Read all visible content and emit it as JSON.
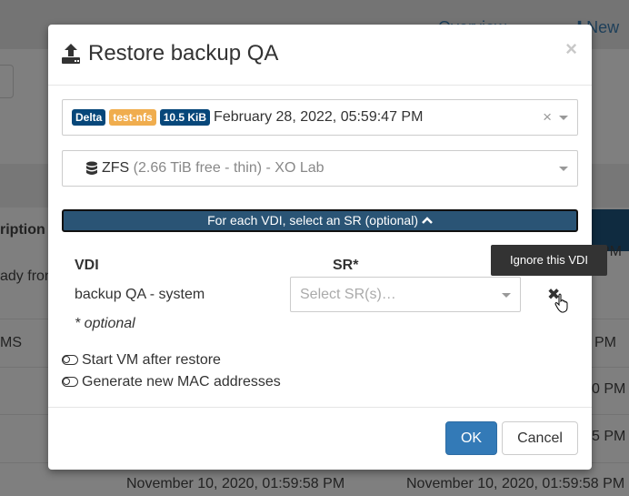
{
  "background": {
    "nav_overview": "Overview",
    "nav_new": "New",
    "col_description": "ription",
    "row1_text": "ady from",
    "row2_text": "MS",
    "times_right": [
      "PM",
      "PM",
      "0 PM",
      "5 PM"
    ],
    "bottom_date_1": "November 10, 2020, 01:59:58 PM",
    "bottom_date_2": "November 10, 2020, 01:59:58 PM"
  },
  "modal": {
    "title": "Restore backup QA",
    "close_label": "×",
    "backup_select": {
      "badges": [
        {
          "label": "Delta",
          "color": "#07477a"
        },
        {
          "label": "test-nfs",
          "color": "#f0ad4e"
        },
        {
          "label": "10.5 KiB",
          "color": "#07477a"
        }
      ],
      "value": "February 28, 2022, 05:59:47 PM",
      "clear": "×"
    },
    "sr_select": {
      "name": "ZFS",
      "detail": "(2.66 TiB free - thin) - XO Lab"
    },
    "vdi_toggle_label": "For each VDI, select an SR (optional)",
    "table": {
      "col_vdi": "VDI",
      "col_sr": "SR*",
      "row_vdi": "backup QA - system",
      "sr_placeholder": "Select SR(s)…",
      "ignore_icon": "✖"
    },
    "tooltip": "Ignore this VDI",
    "optional_note": "* optional",
    "options": [
      {
        "label": "Start VM after restore",
        "on": false
      },
      {
        "label": "Generate new MAC addresses",
        "on": false
      }
    ],
    "ok_label": "OK",
    "cancel_label": "Cancel"
  },
  "colors": {
    "primary": "#337ab7",
    "vdi_button": "#2a5475"
  }
}
